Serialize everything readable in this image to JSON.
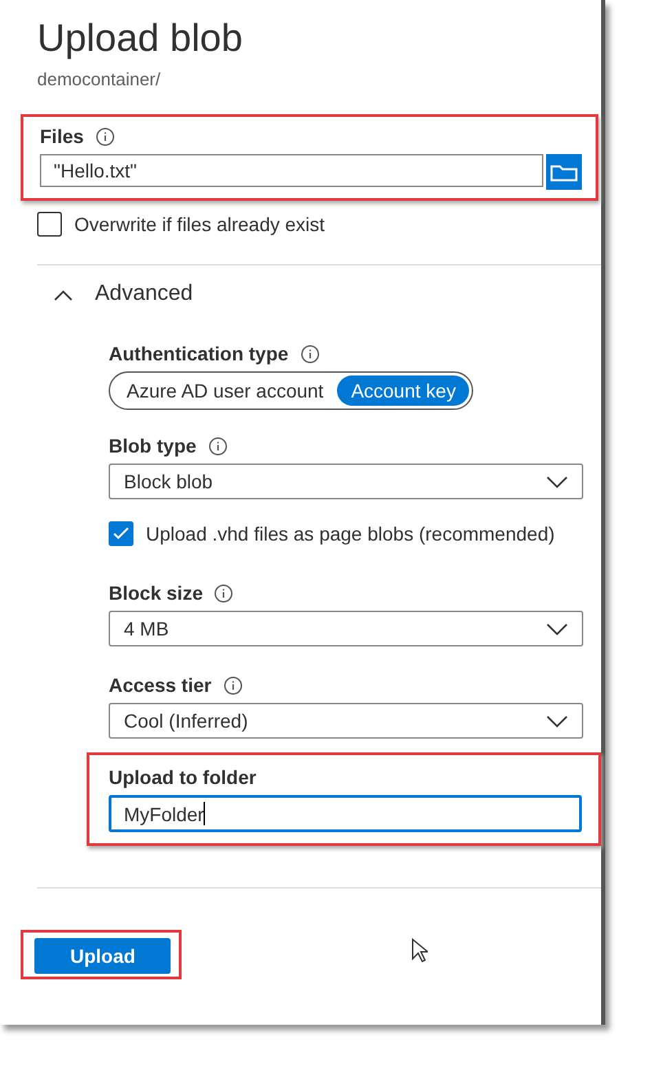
{
  "title": "Upload blob",
  "subtitle": "democontainer/",
  "files": {
    "label": "Files",
    "value": "\"Hello.txt\"",
    "highlighted": true
  },
  "overwrite": {
    "label": "Overwrite if files already exist",
    "checked": false
  },
  "advanced": {
    "label": "Advanced",
    "expanded": true,
    "auth": {
      "label": "Authentication type",
      "options": [
        {
          "label": "Azure AD user account",
          "selected": false
        },
        {
          "label": "Account key",
          "selected": true
        }
      ]
    },
    "blob_type": {
      "label": "Blob type",
      "value": "Block blob"
    },
    "vhd": {
      "label": "Upload .vhd files as page blobs (recommended)",
      "checked": true
    },
    "block_size": {
      "label": "Block size",
      "value": "4 MB"
    },
    "access_tier": {
      "label": "Access tier",
      "value": "Cool (Inferred)"
    },
    "folder": {
      "label": "Upload to folder",
      "value": "MyFolder",
      "highlighted": true
    }
  },
  "upload_button": {
    "label": "Upload",
    "highlighted": true
  }
}
